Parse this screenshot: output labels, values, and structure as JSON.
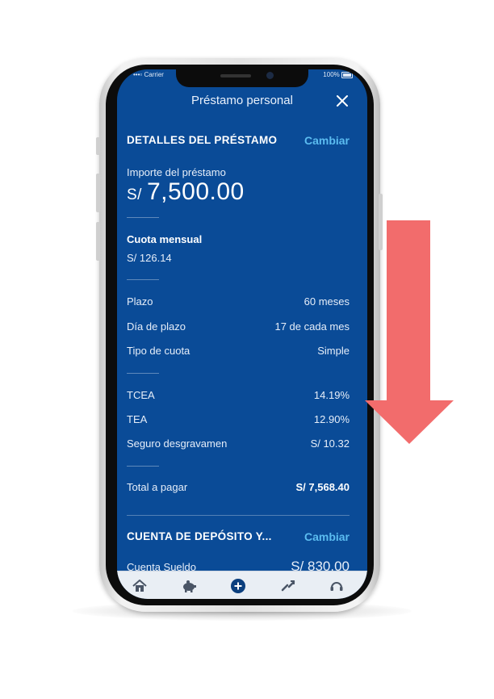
{
  "status_bar": {
    "carrier": "Carrier",
    "battery": "100%"
  },
  "header": {
    "title": "Préstamo personal"
  },
  "loan_details": {
    "section_title": "DETALLES DEL PRÉSTAMO",
    "change_label": "Cambiar",
    "amount_label": "Importe del préstamo",
    "currency": "S/",
    "amount": "7,500.00",
    "monthly_label": "Cuota mensual",
    "monthly_value": "S/ 126.14",
    "rows_a": [
      {
        "label": "Plazo",
        "value": "60 meses"
      },
      {
        "label": "Día de plazo",
        "value": "17 de cada mes"
      },
      {
        "label": "Tipo de cuota",
        "value": "Simple"
      }
    ],
    "rows_b": [
      {
        "label": "TCEA",
        "value": "14.19%"
      },
      {
        "label": "TEA",
        "value": "12.90%"
      },
      {
        "label": "Seguro desgravamen",
        "value": "S/ 10.32"
      }
    ],
    "total_label": "Total a pagar",
    "total_value": "S/ 7,568.40"
  },
  "deposit": {
    "section_title": "CUENTA DE DEPÓSITO Y...",
    "change_label": "Cambiar",
    "account_label": "Cuenta Sueldo",
    "account_value": "S/ 830.00"
  },
  "tab_bar": {
    "icons": [
      "home-icon",
      "piggy-bank-icon",
      "add-icon",
      "transfer-icon",
      "support-icon"
    ]
  },
  "colors": {
    "screen_bg": "#0a4b97",
    "link": "#5bbcf0",
    "arrow": "#f26c6c",
    "tab_accent": "#0b3f7e"
  }
}
